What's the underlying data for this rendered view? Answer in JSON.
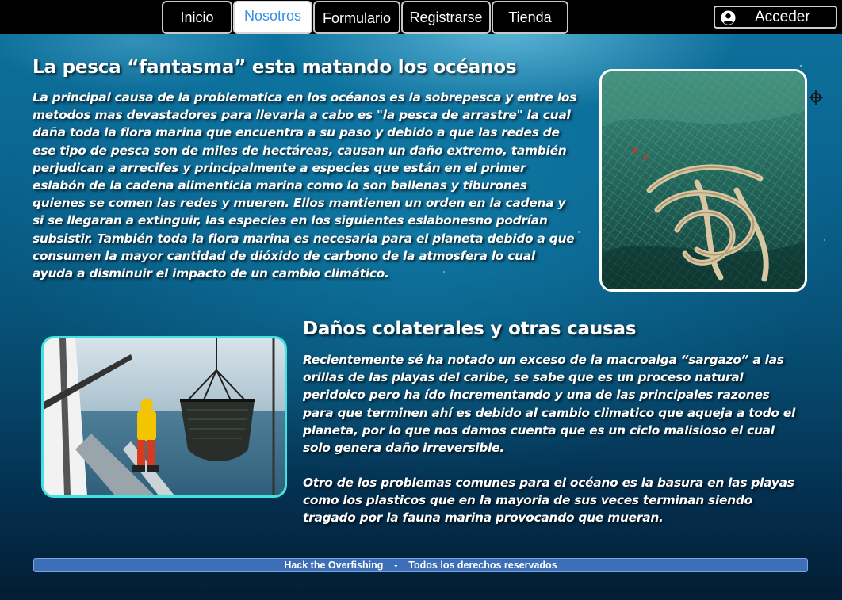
{
  "nav": {
    "items": [
      {
        "label": "Inicio"
      },
      {
        "label": "Nosotros",
        "active": true
      },
      {
        "label": "Formulario"
      },
      {
        "label": "Registrarse"
      },
      {
        "label": "Tienda"
      }
    ],
    "login_label": "Acceder",
    "login_icon": "user-circle-icon"
  },
  "section1": {
    "title": "La pesca “fantasma” esta matando los océanos",
    "body": "La principal causa de la problematica en los océanos es la sobrepesca y entre los metodos mas devastadores para llevarla a cabo es \"la pesca de arrastre\" la cual daña toda la flora marina que encuentra a su paso y debido a que las redes de ese tipo de pesca son de miles de hectáreas, causan un daño extremo, también perjudican a arrecifes y principalmente a especies que están en el primer eslabón de la cadena alimenticia marina como lo son ballenas y tiburones quienes se comen las redes y mueren. Ellos mantienen un orden en la cadena y si se llegaran a extinguir, las especies en los siguientes eslabonesno podrían subsistir. También toda la flora marina es necesaria para el planeta debido a que consumen la mayor cantidad de dióxido de carbono de la atmosfera lo cual ayuda a disminuir el impacto de un cambio climático."
  },
  "section2": {
    "title": "Daños colaterales y otras causas",
    "body1": "Recientemente sé ha notado un exceso de la macroalga “sargazo” a las orillas de las playas del caribe, se sabe que es un proceso natural peridoico pero ha ído incrementando  y una de las principales razones para que terminen ahí es debido al cambio climatico que aqueja a todo el planeta, por lo que nos damos cuenta que es un ciclo malisioso el cual solo genera daño irreversible.",
    "body2": "Otro de los problemas comunes para el océano es la basura en las playas como los plasticos que en la mayoria de sus veces terminan siendo tragado por la fauna marina provocando que mueran."
  },
  "footer": {
    "text": "Hack the Overfishing    -    Todos los derechos reservados"
  },
  "colors": {
    "nav_bg": "#000000",
    "active_tab_text": "#3a8ee0",
    "footer_bg": "#3c6fb8",
    "boat_image_border": "#40e3e0",
    "nets_image_border": "#ffffff"
  },
  "icons": {
    "move": "move-crosshair-icon"
  }
}
